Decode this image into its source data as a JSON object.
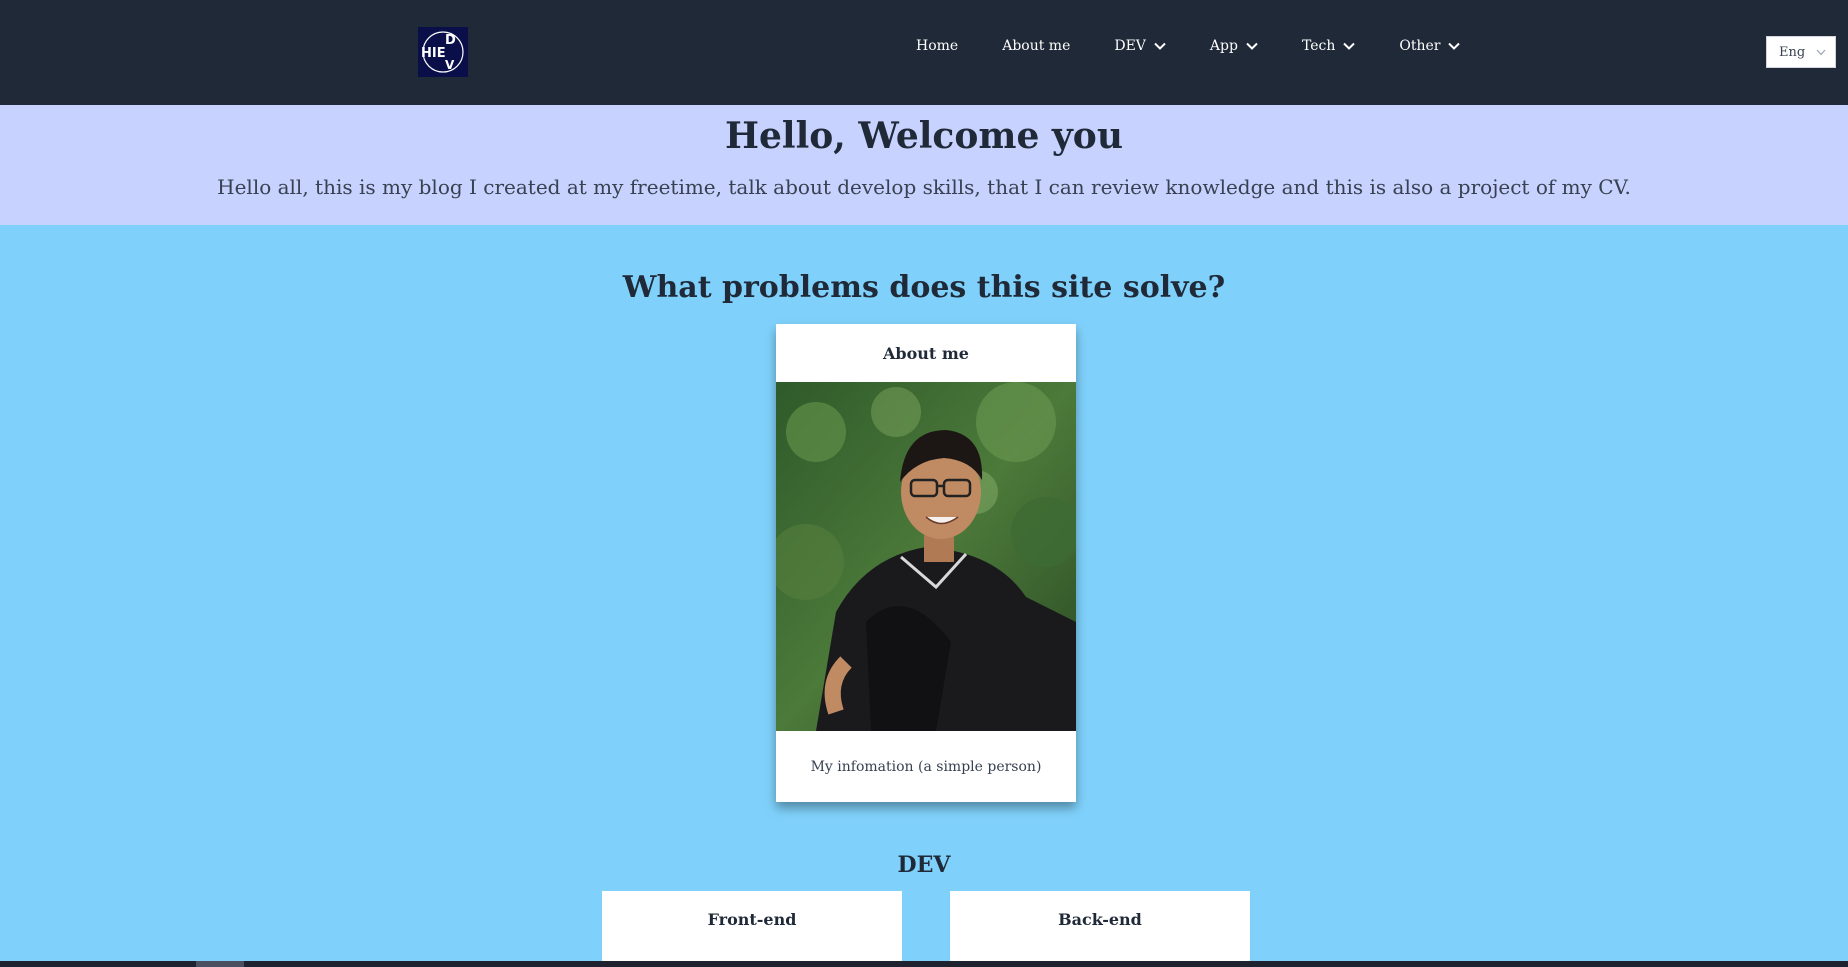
{
  "header": {
    "logo_text": "DHIEV",
    "nav": [
      {
        "label": "Home",
        "dropdown": false
      },
      {
        "label": "About me",
        "dropdown": false
      },
      {
        "label": "DEV",
        "dropdown": true
      },
      {
        "label": "App",
        "dropdown": true
      },
      {
        "label": "Tech",
        "dropdown": true
      },
      {
        "label": "Other",
        "dropdown": true
      }
    ],
    "language": "Eng"
  },
  "hero": {
    "title": "Hello, Welcome you",
    "subtitle": "Hello all, this is my blog I created at my freetime, talk about develop skills, that I can review knowledge and this is also a project of my CV."
  },
  "main": {
    "section_title": "What problems does this site solve?",
    "about_card": {
      "title": "About me",
      "caption": "My infomation (a simple person)"
    },
    "dev": {
      "title": "DEV",
      "cards": [
        {
          "title": "Front-end"
        },
        {
          "title": "Back-end"
        }
      ]
    }
  },
  "colors": {
    "navbar": "#1f2937",
    "hero_bg": "#c7d2fe",
    "page_bg": "#7fd1fb",
    "card_bg": "#ffffff"
  }
}
